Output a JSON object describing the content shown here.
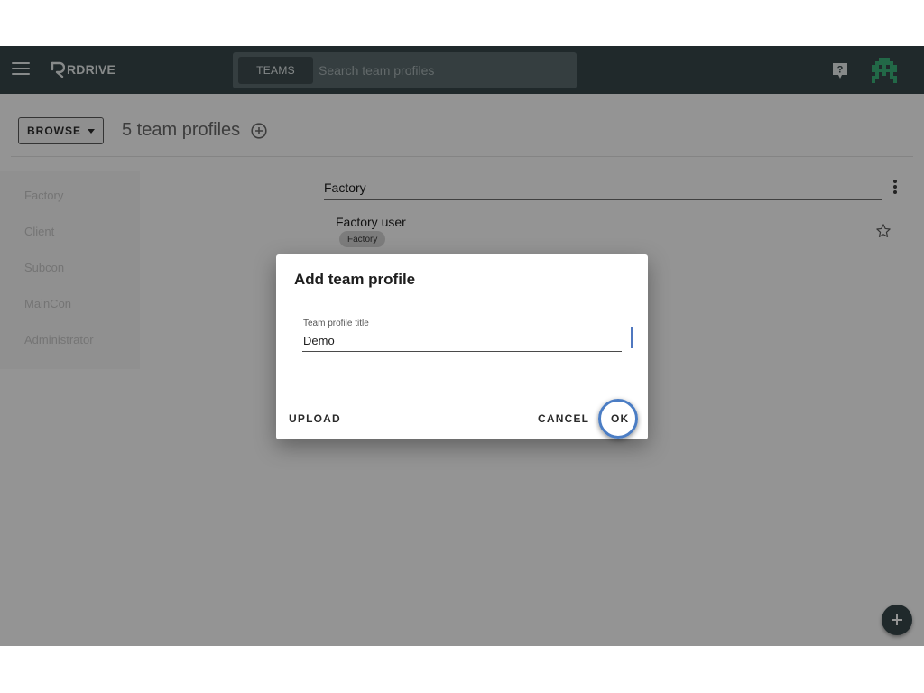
{
  "app": {
    "logo_text": "RDRIVE"
  },
  "search": {
    "tab_label": "TEAMS",
    "placeholder": "Search team profiles",
    "value": ""
  },
  "toolbar": {
    "browse_label": "BROWSE",
    "title": "5 team profiles"
  },
  "sidebar": {
    "items": [
      {
        "label": "Factory"
      },
      {
        "label": "Client"
      },
      {
        "label": "Subcon"
      },
      {
        "label": "MainCon"
      },
      {
        "label": "Administrator"
      }
    ]
  },
  "section": {
    "title": "Factory",
    "profile": {
      "name": "Factory user",
      "tag": "Factory"
    }
  },
  "dialog": {
    "title": "Add team profile",
    "field_label": "Team profile title",
    "field_value": "Demo",
    "upload_label": "UPLOAD",
    "cancel_label": "CANCEL",
    "ok_label": "OK"
  },
  "icons": {
    "menu": "menu-icon",
    "help": "help-icon",
    "avatar": "pixel-avatar-icon",
    "add": "add-circle-icon",
    "more": "more-vert-icon",
    "star": "star-outline-icon",
    "fab": "plus-icon"
  },
  "colors": {
    "appbar": "#37474b",
    "accent": "#4b7dc4",
    "avatar": "#3bb37a"
  }
}
